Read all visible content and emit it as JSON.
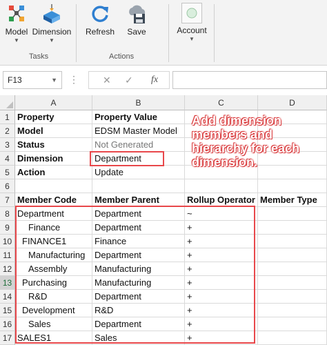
{
  "ribbon": {
    "tasks": {
      "model_label": "Model",
      "dimension_label": "Dimension",
      "group_label": "Tasks"
    },
    "actions": {
      "refresh_label": "Refresh",
      "save_label": "Save",
      "group_label": "Actions"
    },
    "account_label": "Account",
    "icons": {
      "model": "model-icon",
      "dimension": "dimension-icon",
      "refresh": "refresh-icon",
      "save": "cloud-save-icon",
      "account": "account-icon"
    }
  },
  "formula_bar": {
    "name_box": "F13",
    "cancel_symbol": "✕",
    "enter_symbol": "✓",
    "fx_symbol": "fx",
    "formula": ""
  },
  "columns": [
    "A",
    "B",
    "C",
    "D"
  ],
  "rows": [
    {
      "num": "1",
      "a": "Property",
      "b": "Property Value",
      "c": "",
      "d": ""
    },
    {
      "num": "2",
      "a": "Model",
      "b": "EDSM Master Model",
      "c": "",
      "d": ""
    },
    {
      "num": "3",
      "a": "Status",
      "b": "Not Generated",
      "c": "",
      "d": ""
    },
    {
      "num": "4",
      "a": "Dimension",
      "b": "Department",
      "c": "",
      "d": ""
    },
    {
      "num": "5",
      "a": "Action",
      "b": "Update",
      "c": "",
      "d": ""
    },
    {
      "num": "6",
      "a": "",
      "b": "",
      "c": "",
      "d": ""
    },
    {
      "num": "7",
      "a": "Member Code",
      "b": "Member Parent",
      "c": "Rollup Operator",
      "d": "Member Type"
    },
    {
      "num": "8",
      "a": "Department",
      "b": "Department",
      "c": "~",
      "d": ""
    },
    {
      "num": "9",
      "a": "Finance",
      "b": "Department",
      "c": "+",
      "d": ""
    },
    {
      "num": "10",
      "a": "FINANCE1",
      "b": "Finance",
      "c": "+",
      "d": ""
    },
    {
      "num": "11",
      "a": "Manufacturing",
      "b": "Department",
      "c": "+",
      "d": ""
    },
    {
      "num": "12",
      "a": "Assembly",
      "b": "Manufacturing",
      "c": "+",
      "d": ""
    },
    {
      "num": "13",
      "a": "Purchasing",
      "b": "Manufacturing",
      "c": "+",
      "d": ""
    },
    {
      "num": "14",
      "a": "R&D",
      "b": "Department",
      "c": "+",
      "d": ""
    },
    {
      "num": "15",
      "a": "Development",
      "b": "R&D",
      "c": "+",
      "d": ""
    },
    {
      "num": "16",
      "a": "Sales",
      "b": "Department",
      "c": "+",
      "d": ""
    },
    {
      "num": "17",
      "a": "SALES1",
      "b": "Sales",
      "c": "+",
      "d": ""
    }
  ],
  "selected_row": "13",
  "annotation": "Add dimension members and hierarchy for each dimension.",
  "colors": {
    "highlight": "#e8474a",
    "header_bg": "#f0f0f0",
    "selected_text": "#1e6f3a"
  }
}
